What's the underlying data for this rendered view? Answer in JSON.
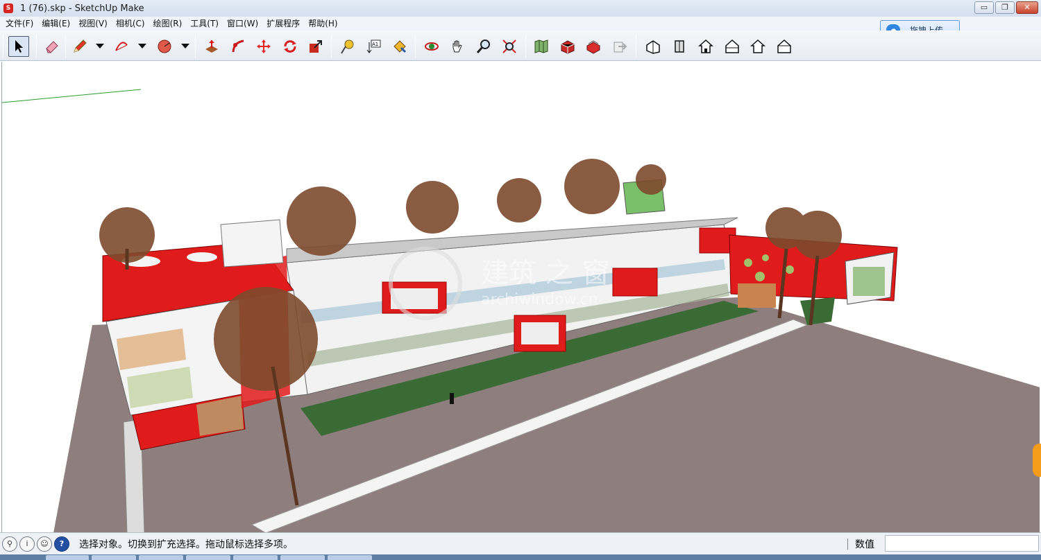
{
  "window": {
    "app_icon": "sketchup-logo-icon",
    "title": "1 (76).skp - SketchUp Make",
    "controls": {
      "minimize": "▭",
      "restore": "❐",
      "close": "✕"
    }
  },
  "menu": [
    "文件(F)",
    "编辑(E)",
    "视图(V)",
    "相机(C)",
    "绘图(R)",
    "工具(T)",
    "窗口(W)",
    "扩展程序",
    "帮助(H)"
  ],
  "upload": {
    "label": "拖拽上传",
    "icon": "cloud-upload-icon"
  },
  "toolbar": {
    "tools": [
      {
        "name": "select-tool",
        "icon": "arrow-cursor-icon",
        "selected": true
      },
      {
        "name": "eraser-tool",
        "icon": "eraser-icon"
      },
      {
        "name": "pencil-tool",
        "icon": "pencil-icon"
      },
      {
        "name": "arc-tool",
        "icon": "arc-icon"
      },
      {
        "name": "shape-tool",
        "icon": "polygon-icon"
      },
      {
        "name": "push-pull-tool",
        "icon": "push-pull-icon"
      },
      {
        "name": "follow-me-tool",
        "icon": "follow-me-icon"
      },
      {
        "name": "move-tool",
        "icon": "move-arrows-icon"
      },
      {
        "name": "rotate-tool",
        "icon": "rotate-icon"
      },
      {
        "name": "scale-tool",
        "icon": "scale-icon"
      },
      {
        "name": "tape-measure-tool",
        "icon": "tape-measure-icon"
      },
      {
        "name": "text-tool",
        "icon": "text-label-icon"
      },
      {
        "name": "paint-bucket-tool",
        "icon": "paint-bucket-icon"
      },
      {
        "name": "orbit-tool",
        "icon": "orbit-icon"
      },
      {
        "name": "pan-tool",
        "icon": "hand-icon"
      },
      {
        "name": "zoom-tool",
        "icon": "magnifier-icon"
      },
      {
        "name": "zoom-extents-tool",
        "icon": "zoom-extents-icon"
      },
      {
        "name": "add-location-tool",
        "icon": "map-icon"
      },
      {
        "name": "3d-warehouse-tool",
        "icon": "warehouse-icon"
      },
      {
        "name": "extension-warehouse-tool",
        "icon": "extension-icon"
      },
      {
        "name": "share-model-tool",
        "icon": "share-icon"
      },
      {
        "name": "iso-view",
        "icon": "iso-house-icon"
      },
      {
        "name": "top-view",
        "icon": "top-view-icon"
      },
      {
        "name": "front-view",
        "icon": "front-house-icon"
      },
      {
        "name": "right-view",
        "icon": "right-house-icon"
      },
      {
        "name": "back-view",
        "icon": "back-house-icon"
      },
      {
        "name": "left-view",
        "icon": "left-house-icon"
      }
    ]
  },
  "viewport": {
    "description_icon": "3d-model-view",
    "watermark": {
      "text_main": "建筑 之 窗",
      "text_sub": "archiwindow.cn"
    },
    "colors": {
      "accent_red": "#e01b1b",
      "ground": "#8f7e7e",
      "wall": "#f2f2f2",
      "roof": "#c9c9c9",
      "grass": "#3a6b35",
      "tree": "#7d4a2c"
    }
  },
  "status": {
    "icons": [
      "geo-location-icon",
      "info-icon",
      "user-icon",
      "help-icon"
    ],
    "message": "选择对象。切换到扩充选择。拖动鼠标选择多项。",
    "measure_label": "数值",
    "measure_value": ""
  }
}
